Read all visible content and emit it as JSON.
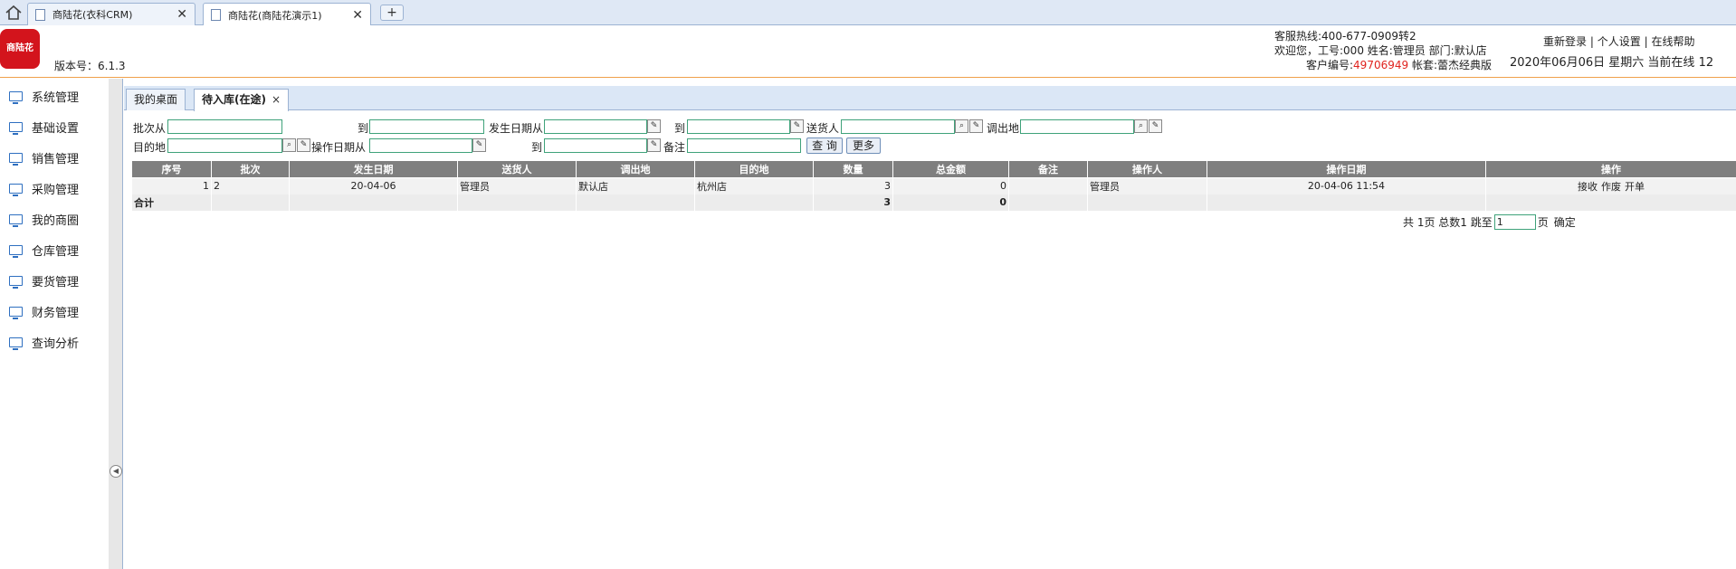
{
  "browser": {
    "tabs": [
      {
        "title": "商陆花(衣科CRM)",
        "active": false
      },
      {
        "title": "商陆花(商陆花演示1)",
        "active": true
      }
    ],
    "new_tab": "+"
  },
  "header": {
    "logo_text": "商陆花",
    "version": "版本号：6.1.3",
    "hotline": "客服热线:400-677-0909转2",
    "welcome": "欢迎您，工号:000 姓名:管理员 部门:默认店",
    "customer_label": "客户编号:",
    "customer_no": "49706949",
    "account": "帐套:蕾杰经典版",
    "links": [
      "重新登录",
      "个人设置",
      "在线帮助"
    ],
    "separator": "|",
    "date_info": "2020年06月06日 星期六 当前在线 12"
  },
  "sidebar": {
    "items": [
      "系统管理",
      "基础设置",
      "销售管理",
      "采购管理",
      "我的商圈",
      "仓库管理",
      "要货管理",
      "财务管理",
      "查询分析"
    ]
  },
  "content_tabs": [
    {
      "label": "我的桌面",
      "active": false
    },
    {
      "label": "待入库(在途)",
      "active": true,
      "close": "×"
    }
  ],
  "filters": {
    "batch_from": "批次从",
    "to": "到",
    "date_from": "发生日期从",
    "sender": "送货人",
    "out_store": "调出地",
    "destination": "目的地",
    "op_date_from": "操作日期从",
    "remark": "备注",
    "query_btn": "查 询",
    "more_btn": "更多"
  },
  "grid": {
    "columns": [
      "序号",
      "批次",
      "发生日期",
      "送货人",
      "调出地",
      "目的地",
      "数量",
      "总金额",
      "备注",
      "操作人",
      "操作日期",
      "操作"
    ],
    "rows": [
      {
        "no": "1",
        "batch": "2",
        "date": "20-04-06",
        "sender": "管理员",
        "from": "默认店",
        "to": "杭州店",
        "qty": "3",
        "amount": "0",
        "remark": "",
        "operator": "管理员",
        "op_date": "20-04-06 11:54",
        "actions": [
          "接收",
          "作废",
          "开单"
        ]
      }
    ],
    "total_label": "合计",
    "total_qty": "3",
    "total_amount": "0"
  },
  "pager": {
    "text": "共 1页 总数1 跳至",
    "page_value": "1",
    "unit": "页",
    "confirm": "确定"
  }
}
